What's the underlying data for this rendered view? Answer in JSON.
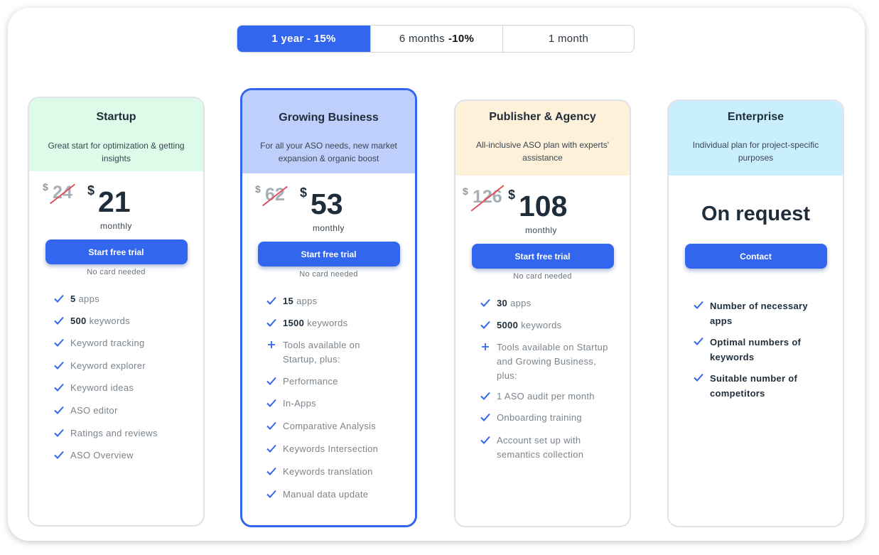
{
  "periods": [
    {
      "label": "1 year - 15%",
      "bold": "",
      "active": true
    },
    {
      "label": "6 months",
      "bold": "-10%",
      "active": false
    },
    {
      "label": "1 month",
      "bold": "",
      "active": false
    }
  ],
  "plans": {
    "startup": {
      "title": "Startup",
      "subtitle": "Great start for optimization & getting insights",
      "currency": "$",
      "old_price": "24",
      "price": "21",
      "period": "monthly",
      "cta": "Start free trial",
      "note": "No card needed",
      "features": [
        {
          "num": "5",
          "text": "apps"
        },
        {
          "num": "500",
          "text": "keywords"
        },
        {
          "num": "",
          "text": "Keyword tracking"
        },
        {
          "num": "",
          "text": "Keyword explorer"
        },
        {
          "num": "",
          "text": "Keyword ideas"
        },
        {
          "num": "",
          "text": "ASO editor"
        },
        {
          "num": "",
          "text": "Ratings and reviews"
        },
        {
          "num": "",
          "text": "ASO Overview"
        }
      ]
    },
    "growing": {
      "title": "Growing Business",
      "subtitle": "For all your ASO needs, new market expansion & organic boost",
      "currency": "$",
      "old_price": "62",
      "price": "53",
      "period": "monthly",
      "cta": "Start free trial",
      "note": "No card needed",
      "features": [
        {
          "num": "15",
          "text": "apps"
        },
        {
          "num": "1500",
          "text": "keywords"
        },
        {
          "num": "",
          "text": "Tools available on Startup, plus:"
        },
        {
          "num": "",
          "text": "Performance"
        },
        {
          "num": "",
          "text": "In-Apps"
        },
        {
          "num": "",
          "text": "Comparative Analysis"
        },
        {
          "num": "",
          "text": "Keywords Intersection"
        },
        {
          "num": "",
          "text": "Keywords translation"
        },
        {
          "num": "",
          "text": "Manual data update"
        }
      ]
    },
    "publisher": {
      "title": "Publisher & Agency",
      "subtitle": "All-inclusive ASO plan with experts' assistance",
      "currency": "$",
      "old_price": "126",
      "price": "108",
      "period": "monthly",
      "cta": "Start free trial",
      "note": "No card needed",
      "features": [
        {
          "num": "30",
          "text": "apps"
        },
        {
          "num": "5000",
          "text": "keywords"
        },
        {
          "num": "",
          "text": "Tools available on Startup and Growing Business, plus:"
        },
        {
          "num": "",
          "text": "1 ASO audit per month"
        },
        {
          "num": "",
          "text": "Onboarding training"
        },
        {
          "num": "",
          "text": "Account set up with semantics collection"
        }
      ]
    },
    "enterprise": {
      "title": "Enterprise",
      "subtitle": "Individual plan for project-specific purposes",
      "price_text": "On request",
      "cta": "Contact",
      "features": [
        {
          "text": "Number of necessary apps"
        },
        {
          "text": "Optimal numbers of keywords"
        },
        {
          "text": "Suitable number of competitors"
        }
      ]
    }
  },
  "colors": {
    "accent": "#3366ee",
    "startup_head": "#dcfbe8",
    "growing_head": "#bdcffa",
    "publisher_head": "#fdf1d9",
    "enterprise_head": "#c9eefd",
    "strike": "#e0505e"
  }
}
